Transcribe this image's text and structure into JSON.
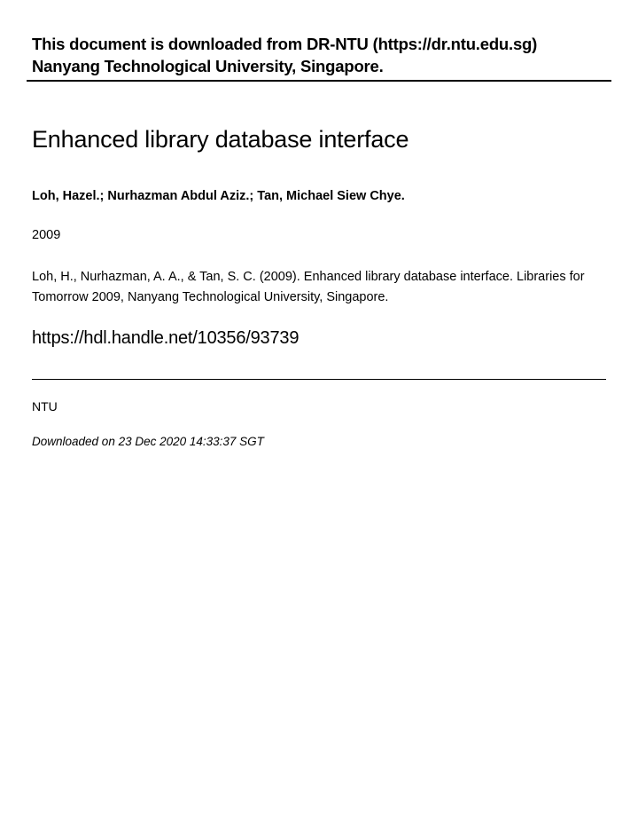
{
  "header": {
    "line1": "This document is downloaded from DR-NTU (https://dr.ntu.edu.sg)",
    "line2": "Nanyang Technological University, Singapore."
  },
  "title": "Enhanced library database interface",
  "authors": "Loh, Hazel.; Nurhazman Abdul Aziz.; Tan, Michael Siew Chye.",
  "year": "2009",
  "citation": "Loh, H., Nurhazman, A. A., & Tan, S. C. (2009). Enhanced library database interface. Libraries for Tomorrow 2009, Nanyang Technological University, Singapore.",
  "url": "https://hdl.handle.net/10356/93739",
  "institution": "NTU",
  "downloaded": "Downloaded on 23 Dec 2020 14:33:37 SGT"
}
